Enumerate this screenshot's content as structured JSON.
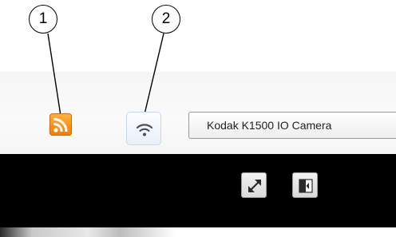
{
  "callouts": [
    {
      "label": "1"
    },
    {
      "label": "2"
    }
  ],
  "toolbar": {
    "rss_icon": "rss-feed-icon",
    "wifi_icon": "wifi-icon",
    "camera_selector": {
      "value": "Kodak K1500 IO Camera"
    }
  },
  "video_controls": {
    "fullscreen_icon": "expand-arrows-icon",
    "split_view_icon": "split-panel-icon"
  },
  "colors": {
    "rss_orange": "#ff9a1f",
    "wifi_blue": "#4a4f5a",
    "black_band": "#000000"
  }
}
